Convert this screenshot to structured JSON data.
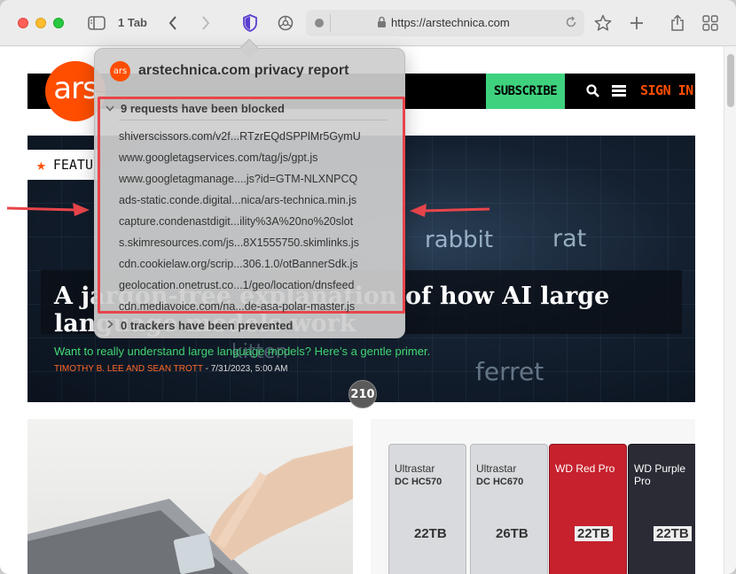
{
  "toolbar": {
    "tab_count": "1 Tab",
    "url": "https://arstechnica.com"
  },
  "site": {
    "logo_text": "ars",
    "subscribe": "SUBSCRIBE",
    "sign_in": "SIGN IN",
    "feature_tag": "FEATU",
    "hero_title": "A jargon-free explanation of how AI large language models work",
    "hero_subtitle": "Want to really understand large language models? Here’s a gentle primer.",
    "byline_author": "TIMOTHY B. LEE AND SEAN TROTT",
    "byline_date": " - 7/31/2023, 5:00 AM",
    "comment_count": "210",
    "hero_words": [
      "rabbit",
      "rat",
      "kitten",
      "ferret"
    ],
    "drives": [
      {
        "brand": "Ultrastar",
        "model": "DC HC570",
        "capacity": "22TB"
      },
      {
        "brand": "Ultrastar",
        "model": "DC HC670",
        "capacity": "26TB"
      },
      {
        "brand": "WD Red Pro",
        "model": "",
        "capacity": "22TB"
      },
      {
        "brand": "WD Purple Pro",
        "model": "",
        "capacity": "22TB"
      }
    ]
  },
  "privacy_report": {
    "favicon_text": "ars",
    "title": "arstechnica.com privacy report",
    "blocked_header": "9 requests have been blocked",
    "blocked_items": [
      "shiverscissors.com/v2f...RTzrEQdSPPlMr5GymU",
      "www.googletagservices.com/tag/js/gpt.js",
      "www.googletagmanage....js?id=GTM-NLXNPCQ",
      "ads-static.conde.digital...nica/ars-technica.min.js",
      "capture.condenastdigit...ility%3A%20no%20slot",
      "s.skimresources.com/js...8X1555750.skimlinks.js",
      "cdn.cookielaw.org/scrip...306.1.0/otBannerSdk.js",
      "geolocation.onetrust.co...1/geo/location/dnsfeed",
      "cdn.mediavoice.com/na...de-asa-polar-master.js"
    ],
    "trackers_header": "0 trackers have been prevented"
  },
  "colors": {
    "ars_orange": "#ff4e00",
    "subscribe_green": "#3fd27e",
    "highlight_red": "#e8454b",
    "privacy_shield": "#5b3fd1"
  }
}
